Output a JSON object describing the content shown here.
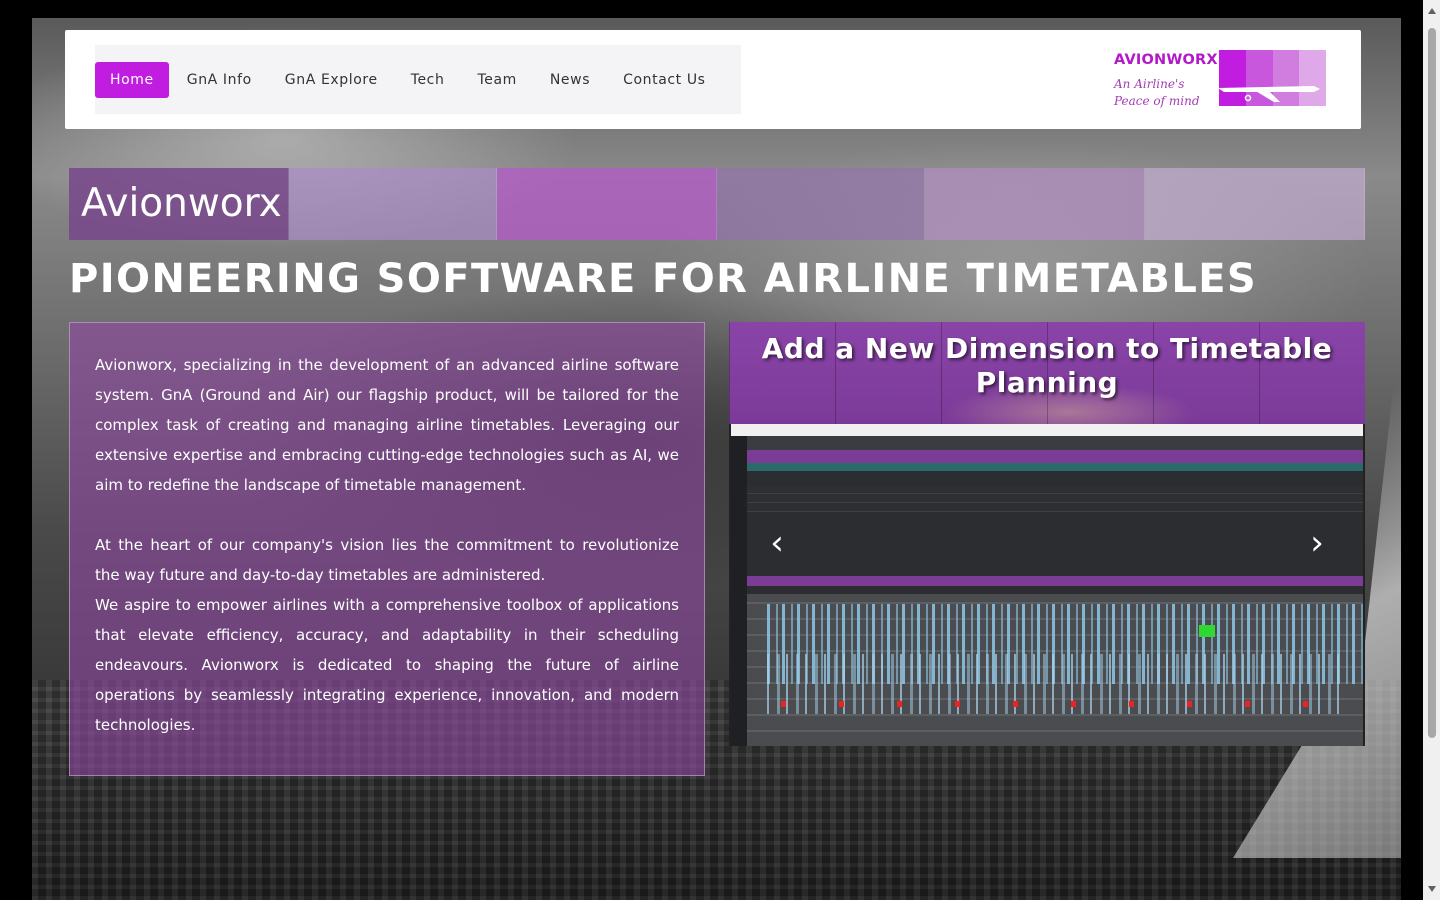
{
  "nav": {
    "items": [
      {
        "label": "Home",
        "active": true
      },
      {
        "label": "GnA Info"
      },
      {
        "label": "GnA Explore"
      },
      {
        "label": "Tech"
      },
      {
        "label": "Team"
      },
      {
        "label": "News"
      },
      {
        "label": "Contact Us"
      }
    ]
  },
  "logo": {
    "word": "AVIONWORX",
    "tagline_line1": "An Airline's",
    "tagline_line2": "Peace of mind",
    "block_colors": [
      "#c01de0",
      "#c957dd",
      "#d17ddf",
      "#dfa8e8"
    ]
  },
  "hero": {
    "band_title": "Avionworx",
    "band_colors": [
      "rgba(120,70,140,0.85)",
      "rgba(170,140,200,0.7)",
      "rgba(180,90,200,0.75)",
      "rgba(150,110,180,0.55)",
      "rgba(190,140,210,0.55)",
      "rgba(210,180,225,0.55)"
    ],
    "headline": "PIONEERING SOFTWARE FOR AIRLINE TIMETABLES"
  },
  "about": {
    "p1": "Avionworx, specializing in the development of an advanced airline software system. GnA (Ground and Air) our flagship product, will be tailored for the complex task of creating and managing airline timetables. Leveraging our extensive expertise and embracing cutting-edge technologies such as AI, we aim to redefine the landscape of timetable management.",
    "p2": "At the heart of our company's vision lies the commitment to revolutionize the way future and day-to-day timetables are administered.",
    "p3": "We aspire to empower airlines with a comprehensive toolbox of applications that elevate efficiency, accuracy, and adaptability in their scheduling endeavours. Avionworx is dedicated to shaping the future of airline operations by seamlessly integrating experience, innovation, and modern technologies."
  },
  "carousel": {
    "title": "Add a New Dimension to Timetable Planning",
    "prev_icon": "chevron-left-icon",
    "next_icon": "chevron-right-icon",
    "prev_glyph": "‹",
    "next_glyph": "›"
  },
  "colors": {
    "accent": "#c01de0",
    "panel": "#8c48a0"
  }
}
